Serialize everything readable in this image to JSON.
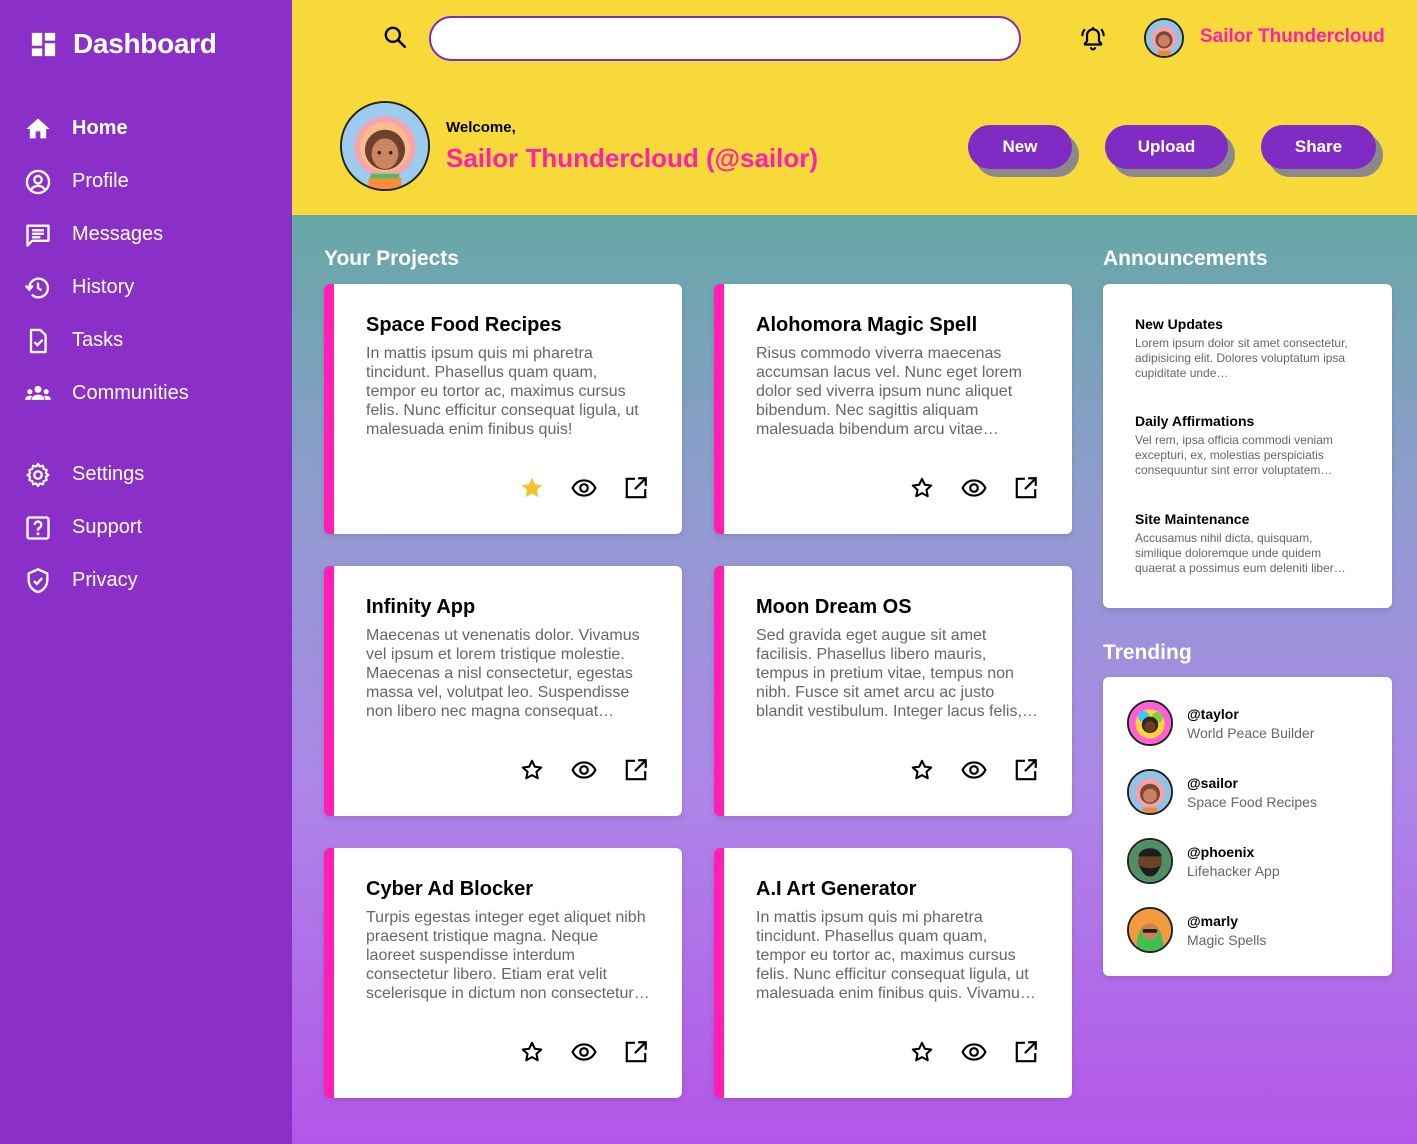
{
  "app": {
    "title": "Dashboard"
  },
  "sidebar": {
    "items": [
      {
        "label": "Home",
        "icon": "home-icon"
      },
      {
        "label": "Profile",
        "icon": "profile-icon"
      },
      {
        "label": "Messages",
        "icon": "messages-icon"
      },
      {
        "label": "History",
        "icon": "history-icon"
      },
      {
        "label": "Tasks",
        "icon": "tasks-icon"
      },
      {
        "label": "Communities",
        "icon": "communities-icon"
      },
      {
        "label": "Settings",
        "icon": "gear-icon"
      },
      {
        "label": "Support",
        "icon": "support-icon"
      },
      {
        "label": "Privacy",
        "icon": "shield-icon"
      }
    ]
  },
  "header": {
    "search": {
      "value": "",
      "placeholder": ""
    },
    "username": "Sailor Thundercloud",
    "welcome": "Welcome,",
    "welcome_name": "Sailor Thundercloud (@sailor)",
    "buttons": {
      "new": "New",
      "upload": "Upload",
      "share": "Share"
    }
  },
  "projects": {
    "title": "Your Projects",
    "items": [
      {
        "title": "Space Food Recipes",
        "desc": "In mattis ipsum quis mi pharetra tincidunt. Phasellus quam quam, tempor eu tortor ac, maximus cursus felis. Nunc efficitur consequat ligula, ut malesuada enim finibus quis!",
        "starred": true
      },
      {
        "title": "Alohomora Magic Spell",
        "desc": "Risus commodo viverra maecenas accumsan lacus vel. Nunc eget lorem dolor sed viverra ipsum nunc aliquet bibendum. Nec sagittis aliquam malesuada bibendum arcu vitae…",
        "starred": false
      },
      {
        "title": "Infinity App",
        "desc": "Maecenas ut venenatis dolor. Vivamus vel ipsum et lorem tristique molestie. Maecenas a nisl consectetur, egestas massa vel, volutpat leo. Suspendisse non libero nec magna consequat…",
        "starred": false
      },
      {
        "title": "Moon Dream OS",
        "desc": "Sed gravida eget augue sit amet facilisis. Phasellus libero mauris, tempus in pretium vitae, tempus non nibh. Fusce sit amet arcu ac justo blandit vestibulum. Integer lacus felis,…",
        "starred": false
      },
      {
        "title": "Cyber Ad Blocker",
        "desc": "Turpis egestas integer eget aliquet nibh praesent tristique magna. Neque laoreet suspendisse interdum consectetur libero. Etiam erat velit scelerisque in dictum non consectetur…",
        "starred": false
      },
      {
        "title": "A.I Art Generator",
        "desc": "In mattis ipsum quis mi pharetra tincidunt. Phasellus quam quam, tempor eu tortor ac, maximus cursus felis. Nunc efficitur consequat ligula, ut malesuada enim finibus quis. Vivamu…",
        "starred": false
      }
    ]
  },
  "announcements": {
    "title": "Announcements",
    "items": [
      {
        "title": "New Updates",
        "text": "Lorem ipsum dolor sit amet consectetur, adipisicing elit. Dolores voluptatum ipsa cupiditate unde…"
      },
      {
        "title": "Daily Affirmations",
        "text": "Vel rem, ipsa officia commodi veniam excepturi, ex, molestias perspiciatis consequuntur sint error voluptatem…"
      },
      {
        "title": "Site Maintenance",
        "text": "Accusamus nihil dicta, quisquam, similique doloremque unde quidem quaerat a possimus eum deleniti liber…"
      }
    ]
  },
  "trending": {
    "title": "Trending",
    "items": [
      {
        "handle": "@taylor",
        "project": "World Peace Builder"
      },
      {
        "handle": "@sailor",
        "project": "Space Food Recipes"
      },
      {
        "handle": "@phoenix",
        "project": "Lifehacker App"
      },
      {
        "handle": "@marly",
        "project": "Magic Spells"
      }
    ]
  },
  "colors": {
    "sidebar": "#8a2fc7",
    "header": "#f7d93a",
    "accent_pink": "#ff1fb4",
    "button_purple": "#7f2bc4",
    "star_gold": "#f5c330"
  }
}
